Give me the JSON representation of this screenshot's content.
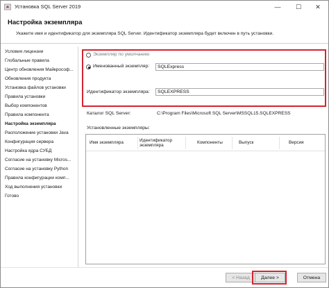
{
  "window": {
    "title": "Установка SQL Server 2019",
    "min_glyph": "—",
    "max_glyph": "☐",
    "close_glyph": "✕"
  },
  "header": {
    "title": "Настройка экземпляра",
    "description": "Укажите имя и идентификатор для экземпляра SQL Server. Идентификатор экземпляра будет включен в путь установки."
  },
  "sidebar": {
    "items": [
      {
        "label": "Условия лицензии"
      },
      {
        "label": "Глобальные правила"
      },
      {
        "label": "Центр обновления Майкрософ..."
      },
      {
        "label": "Обновления продукта"
      },
      {
        "label": "Установка файлов установки"
      },
      {
        "label": "Правила установки"
      },
      {
        "label": "Выбор компонентов"
      },
      {
        "label": "Правила компонента"
      },
      {
        "label": "Настройка экземпляра"
      },
      {
        "label": "Расположение установки Java"
      },
      {
        "label": "Конфигурация сервера"
      },
      {
        "label": "Настройка ядра СУБД"
      },
      {
        "label": "Согласие на установку Micros..."
      },
      {
        "label": "Согласие на установку Python"
      },
      {
        "label": "Правила конфигурации комп..."
      },
      {
        "label": "Ход выполнения установки"
      },
      {
        "label": "Готово"
      }
    ],
    "active_index": 8
  },
  "instance": {
    "default_label": "Экземпляр по умолчанию",
    "named_label": "Именованный экземпляр:",
    "named_value": "SQLExpress",
    "id_label": "Идентификатор экземпляра:",
    "id_value": "SQLEXPRESS"
  },
  "catalog": {
    "label": "Каталог SQL Server:",
    "value": "C:\\Program Files\\Microsoft SQL Server\\MSSQL15.SQLEXPRESS"
  },
  "installed": {
    "label": "Установленные экземпляры:",
    "columns": [
      "Имя экземпляра",
      "Идентификатор экземпляра",
      "Компоненты",
      "Выпуск",
      "Версия"
    ]
  },
  "buttons": {
    "back": "< Назад",
    "next": "Далее >",
    "cancel": "Отмена"
  },
  "colors": {
    "highlight": "#d42330"
  }
}
